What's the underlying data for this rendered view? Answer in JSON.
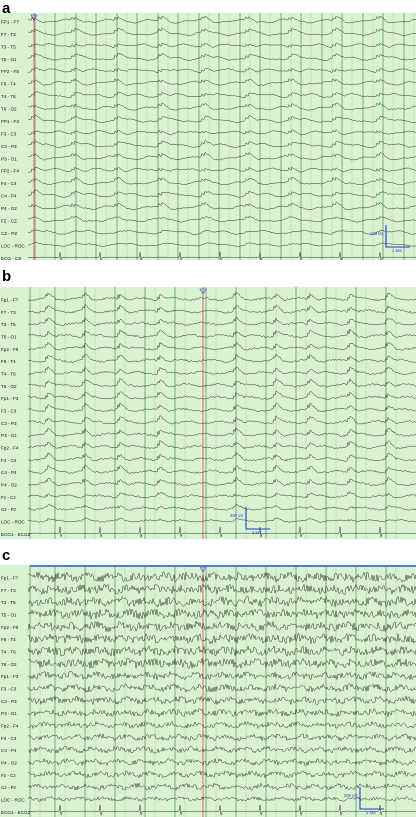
{
  "panels": [
    {
      "label": "a",
      "channels": [
        "FP1 - F7",
        "F7 - T3",
        "T3 - T5",
        "T5 - O1",
        "FP2 - F8",
        "F8 - T4",
        "T4 - T6",
        "T6 - O2",
        "FP1 - F3",
        "F3 - C3",
        "C3 - P3",
        "P3 - O1",
        "FP2 - F4",
        "F4 - C4",
        "C4 - P4",
        "P4 - O2",
        "FZ - CZ",
        "CZ - PZ",
        "LOC - ROC",
        "ECG - C8"
      ],
      "scale_amplitude": "100 uV",
      "scale_time": "1 sec"
    },
    {
      "label": "b",
      "channels": [
        "Fp1 - F7",
        "F7 - T3",
        "T3 - T5",
        "T5 - O1",
        "Fp2 - F8",
        "F8 - T4",
        "T4 - T6",
        "T6 - O2",
        "Fp1 - F3",
        "F3 - C3",
        "C3 - P3",
        "P3 - O1",
        "Fp2 - F4",
        "F4 - C4",
        "C4 - P4",
        "P4 - O2",
        "Fz - Cz",
        "Cz - Pz",
        "LOC - ROC",
        "ECG1 - ECG2"
      ],
      "scale_amplitude": "200 uV",
      "scale_time": "1 sec"
    },
    {
      "label": "c",
      "channels": [
        "Fp1 - F7",
        "F7 - T3",
        "T3 - T5",
        "T5 - O1",
        "Fp2 - F8",
        "F8 - T4",
        "T4 - T6",
        "T6 - O2",
        "Fp1 - F3",
        "F3 - C3",
        "C3 - P3",
        "P3 - O1",
        "Fp2 - F4",
        "F4 - C4",
        "C4 - P4",
        "P4 - O2",
        "Fz - Cz",
        "Cz - Pz",
        "LOC - ROC",
        "ECG1 - ECG2"
      ],
      "scale_amplitude": "200 uV",
      "scale_time": "1 sec"
    }
  ],
  "colors": {
    "background": "#d9f2d0",
    "trace": "#1a1a1a",
    "gridline": "#2f6a2f",
    "gridline_faint": "#8fc48a",
    "event_marker": "#e08080",
    "scale_bar": "#1c3fd6",
    "cursor_marker": "#4a6ee0",
    "top_highlight": "#4a7fd6"
  },
  "chart_data": [
    {
      "type": "line",
      "title": "",
      "channel_count": 20,
      "scale_amplitude": "100 uV",
      "scale_time": "1 sec",
      "grid": true,
      "pattern": "slow periodic discharges"
    },
    {
      "type": "line",
      "title": "",
      "channel_count": 20,
      "scale_amplitude": "200 uV",
      "scale_time": "1 sec",
      "grid": true,
      "pattern": "periodic sharp waves"
    },
    {
      "type": "line",
      "title": "",
      "channel_count": 20,
      "scale_amplitude": "200 uV",
      "scale_time": "1 sec",
      "grid": true,
      "pattern": "high-frequency activity"
    }
  ]
}
